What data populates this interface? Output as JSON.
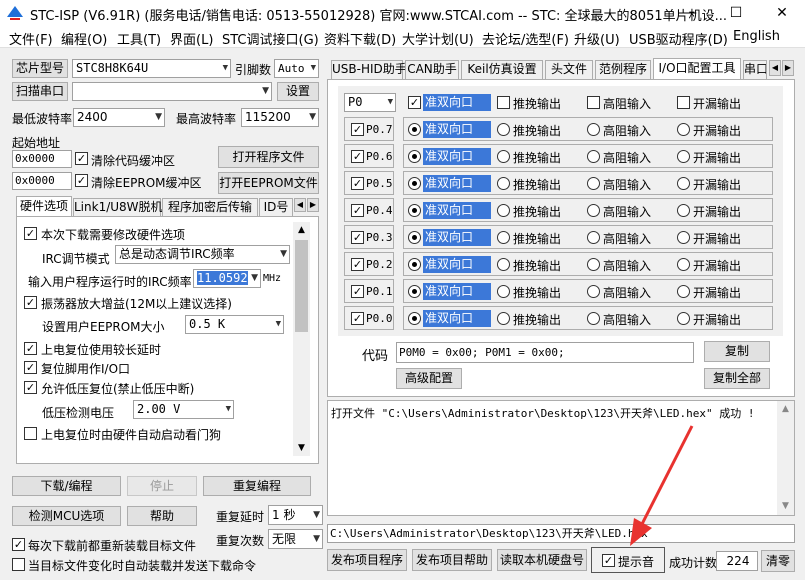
{
  "window": {
    "title": "STC-ISP (V6.91R) (服务电话/销售电话: 0513-55012928) 官网:www.STCAI.com  -- STC: 全球最大的8051单片机设..."
  },
  "menu": [
    "文件(F)",
    "编程(O)",
    "工具(T)",
    "界面(L)",
    "STC调试接口(G)",
    "资料下载(D)",
    "大学计划(U)",
    "去论坛/选型(F)",
    "升级(U)",
    "USB驱动程序(D)",
    "English"
  ],
  "left": {
    "chip_type_btn": "芯片型号",
    "chip_model": "STC8H8K64U",
    "pin_count_label": "引脚数",
    "pin_count": "Auto",
    "scan_port_btn": "扫描串口",
    "port_value": "",
    "settings_btn": "设置",
    "min_baud_label": "最低波特率",
    "min_baud": "2400",
    "max_baud_label": "最高波特率",
    "max_baud": "115200",
    "start_addr_label": "起始地址",
    "addr1": "0x0000",
    "clear_code_label": "清除代码缓冲区",
    "open_prog_btn": "打开程序文件",
    "addr2": "0x0000",
    "clear_eeprom_label": "清除EEPROM缓冲区",
    "open_eeprom_btn": "打开EEPROM文件",
    "tabs": [
      "硬件选项",
      "Link1/U8W脱机",
      "程序加密后传输",
      "ID号"
    ],
    "hw": {
      "opt_modify": "本次下载需要修改硬件选项",
      "irc_mode_label": "IRC调节模式",
      "irc_mode": "总是动态调节IRC频率",
      "freq_label": "输入用户程序运行时的IRC频率",
      "freq_value": "11.0592",
      "freq_unit": "MHz",
      "osc_gain": "振荡器放大增益(12M以上建议选择)",
      "eeprom_size_label": "设置用户EEPROM大小",
      "eeprom_size": "0.5 K",
      "long_delay": "上电复位使用较长延时",
      "reset_pin_io": "复位脚用作I/O口",
      "low_volt_reset": "允许低压复位(禁止低压中断)",
      "low_volt_label": "低压检测电压",
      "low_volt": "2.00 V",
      "auto_wdt": "上电复位时由硬件自动启动看门狗"
    },
    "download_btn": "下载/编程",
    "stop_btn": "停止",
    "reprogram_btn": "重复编程",
    "detect_btn": "检测MCU选项",
    "help_btn": "帮助",
    "repeat_delay_label": "重复延时",
    "repeat_delay": "1 秒",
    "repeat_count_label": "重复次数",
    "repeat_count": "无限",
    "reload_label": "每次下载前都重新装载目标文件",
    "auto_send_label": "当目标文件变化时自动装载并发送下载命令"
  },
  "right": {
    "tabs": [
      "USB-HID助手",
      "CAN助手",
      "Keil仿真设置",
      "头文件",
      "范例程序",
      "I/O口配置工具",
      "串口"
    ],
    "port_select": "P0",
    "modes": [
      "准双向口",
      "推挽输出",
      "高阻输入",
      "开漏输出"
    ],
    "pins": [
      "P0.7",
      "P0.6",
      "P0.5",
      "P0.4",
      "P0.3",
      "P0.2",
      "P0.1",
      "P0.0"
    ],
    "code_label": "代码",
    "code_value": "P0M0 = 0x00; P0M1 = 0x00;",
    "copy_btn": "复制",
    "advanced_btn": "高级配置",
    "copy_all_btn": "复制全部",
    "log_text": "打开文件 \"C:\\Users\\Administrator\\Desktop\\123\\开天斧\\LED.hex\" 成功 !",
    "file_path": "C:\\Users\\Administrator\\Desktop\\123\\开天斧\\LED.hex",
    "publish_prog_btn": "发布项目程序",
    "publish_help_btn": "发布项目帮助",
    "read_disk_btn": "读取本机硬盘号",
    "sound_label": "提示音",
    "success_label": "成功计数",
    "success_count": "224",
    "clear_btn": "清零"
  },
  "colors": {
    "accent": "#3c78d8",
    "annotation": "#e8322f"
  }
}
